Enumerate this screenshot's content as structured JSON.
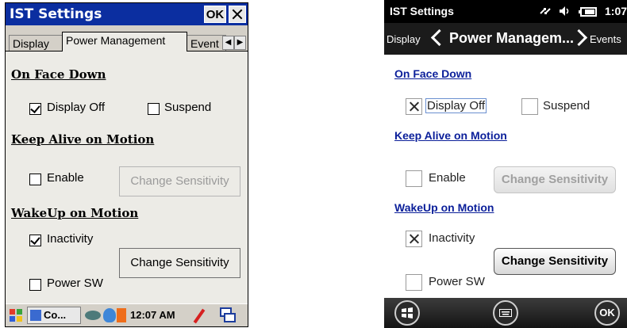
{
  "left": {
    "title": "IST Settings",
    "ok_label": "OK",
    "tabs": [
      "Display",
      "Power Management",
      "Event"
    ],
    "sections": {
      "face_down": "On Face Down",
      "keep_alive": "Keep Alive on Motion",
      "wakeup": "WakeUp on Motion"
    },
    "checkboxes": {
      "display_off": {
        "label": "Display Off",
        "checked": true
      },
      "suspend": {
        "label": "Suspend",
        "checked": false
      },
      "enable": {
        "label": "Enable",
        "checked": false
      },
      "inactivity": {
        "label": "Inactivity",
        "checked": true
      },
      "power_sw": {
        "label": "Power SW",
        "checked": false
      }
    },
    "buttons": {
      "change_sensitivity_keep": "Change Sensitivity",
      "change_sensitivity_wake": "Change Sensitivity"
    },
    "taskbar": {
      "app_label": "Co...",
      "time": "12:07 AM"
    }
  },
  "right": {
    "title": "IST Settings",
    "time": "1:07",
    "nav": {
      "prev": "Display",
      "current": "Power Managem...",
      "next": "Events"
    },
    "sections": {
      "face_down": "On Face Down",
      "keep_alive": "Keep Alive on Motion",
      "wakeup": "WakeUp on Motion"
    },
    "checkboxes": {
      "display_off": {
        "label": "Display Off",
        "checked": true
      },
      "suspend": {
        "label": "Suspend",
        "checked": false
      },
      "enable": {
        "label": "Enable",
        "checked": false
      },
      "inactivity": {
        "label": "Inactivity",
        "checked": true
      },
      "power_sw": {
        "label": "Power SW",
        "checked": false
      }
    },
    "buttons": {
      "change_sensitivity_keep": "Change Sensitivity",
      "change_sensitivity_wake": "Change Sensitivity"
    },
    "softkeys": {
      "ok": "OK"
    }
  }
}
